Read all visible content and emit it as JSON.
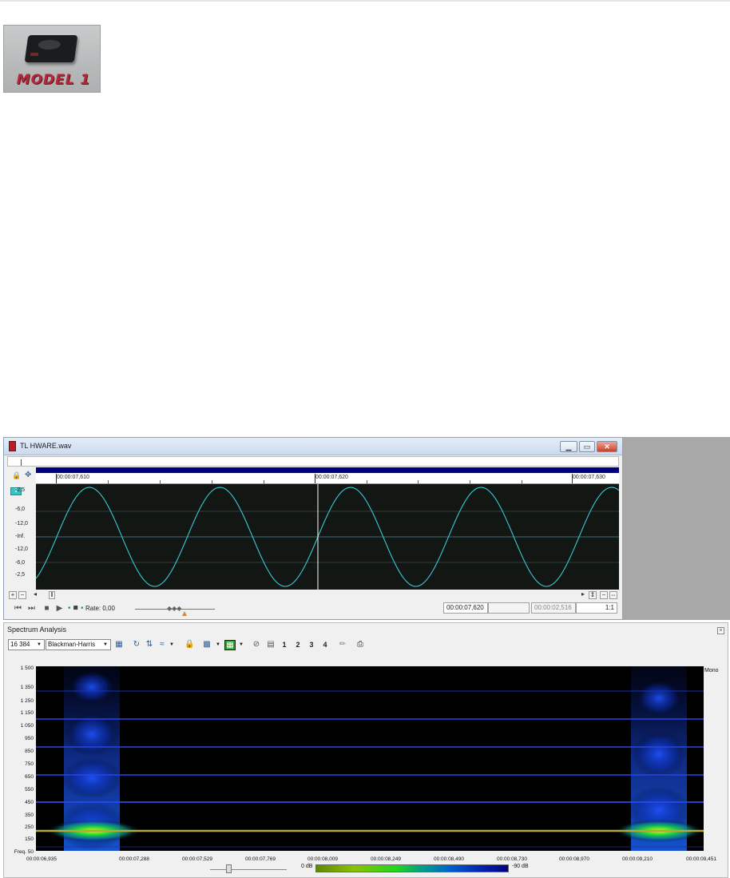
{
  "logo": {
    "text": "MODEL 1"
  },
  "wave_window": {
    "title": "TL HWARE.wav",
    "ctrl": {
      "min": "▁",
      "max": "▭",
      "close": "✕"
    },
    "time_marks": [
      "00:00:07,610",
      "00:00:07,620",
      "00:00:07,630"
    ],
    "track_number": "1",
    "db_labels": [
      "-2,5",
      "-6,0",
      "-12,0",
      "-Inf.",
      "-12,0",
      "-6,0",
      "-2,5"
    ],
    "rate_label": "Rate: 0,00",
    "cursor_time": "00:00:07,620",
    "length_time": "00:00:02,516",
    "zoom_ratio": "1:1",
    "scroll": {
      "plus": "+",
      "minus": "−",
      "left": "◂",
      "thumb": "‖",
      "right": "▸"
    }
  },
  "spectrum": {
    "title": "Spectrum Analysis",
    "fft_size": "16 384",
    "window_fn": "Blackman-Harris",
    "buttons": {
      "n1": "1",
      "n2": "2",
      "n3": "3",
      "n4": "4"
    },
    "channel_label": "Mono",
    "freq_labels": [
      "1 500",
      "1 350",
      "1 250",
      "1 150",
      "1 050",
      "950",
      "850",
      "750",
      "650",
      "550",
      "450",
      "350",
      "250",
      "150",
      "Freq. 50"
    ],
    "time_labels": [
      "00:00:06,935",
      "00:00:07,288",
      "00:00:07,529",
      "00:00:07,769",
      "00:00:08,009",
      "00:00:08,249",
      "00:00:08,490",
      "00:00:08,730",
      "00:00:08,970",
      "00:00:09,210",
      "00:00:09,451"
    ],
    "colorbar_low": "0 dB",
    "colorbar_high": "-90 dB"
  }
}
